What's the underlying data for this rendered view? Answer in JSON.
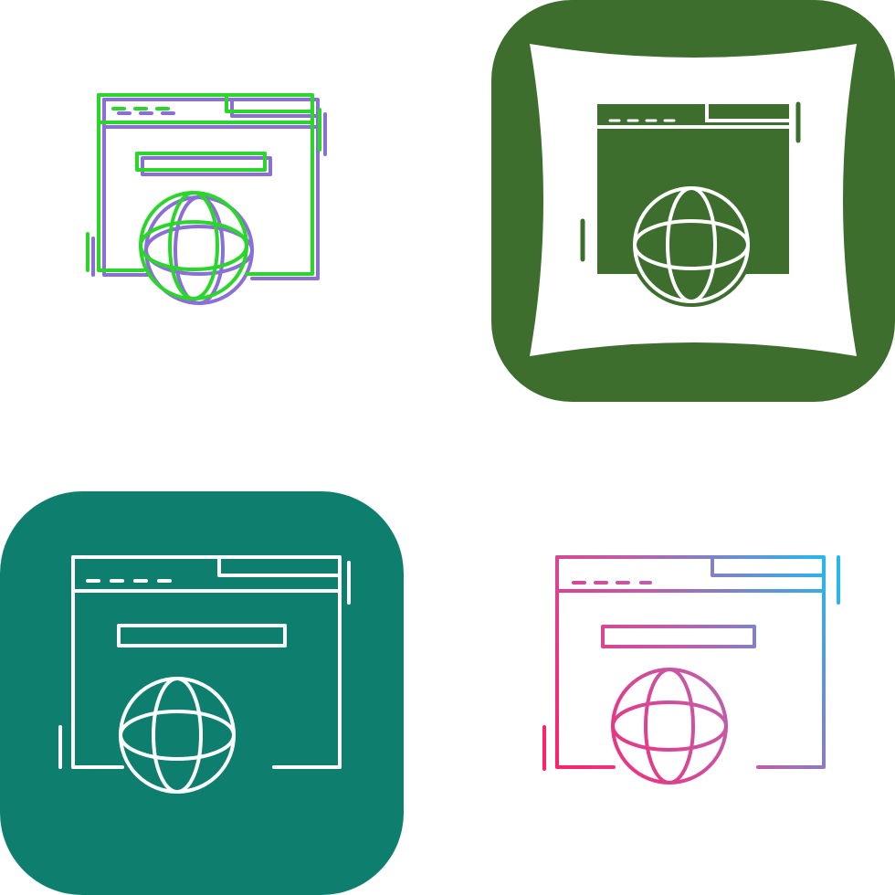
{
  "icon_set": {
    "subject": "web-browser-globe",
    "variants": [
      {
        "style": "duotone-line",
        "icon": "browser-globe-icon",
        "colors": {
          "primary": "#2bd62b",
          "secondary": "#8a6fd6"
        }
      },
      {
        "style": "glyph-on-pillow-badge",
        "icon": "browser-globe-icon",
        "colors": {
          "badge": "#3d6e2e",
          "glyph": "#3d6e2e",
          "line": "#ffffff"
        }
      },
      {
        "style": "line-on-rounded-square",
        "icon": "browser-globe-icon",
        "colors": {
          "badge": "#0e7f6f",
          "line": "#ffffff"
        }
      },
      {
        "style": "gradient-line",
        "icon": "browser-globe-icon",
        "colors": {
          "gradient_start": "#ff1f6a",
          "gradient_end": "#22b9f0"
        }
      }
    ]
  }
}
